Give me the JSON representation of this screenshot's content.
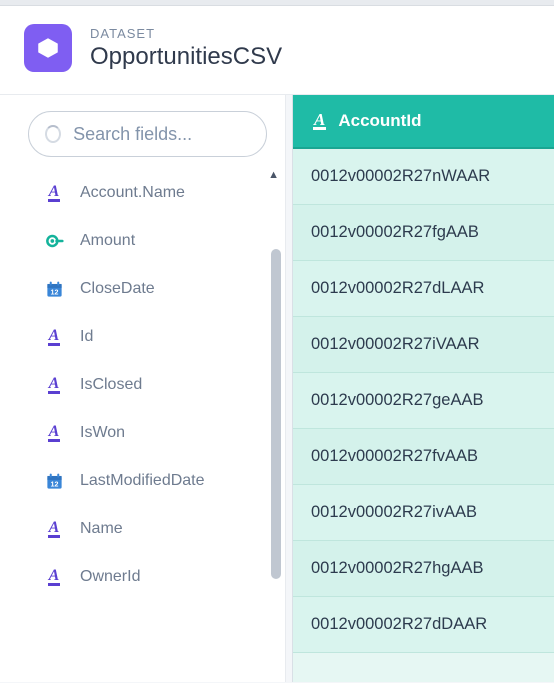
{
  "header": {
    "label": "DATASET",
    "title": "OpportunitiesCSV"
  },
  "search": {
    "placeholder": "Search fields..."
  },
  "fields": [
    {
      "label": "Account.Name",
      "type": "text"
    },
    {
      "label": "Amount",
      "type": "measure"
    },
    {
      "label": "CloseDate",
      "type": "date"
    },
    {
      "label": "Id",
      "type": "text"
    },
    {
      "label": "IsClosed",
      "type": "text"
    },
    {
      "label": "IsWon",
      "type": "text"
    },
    {
      "label": "LastModifiedDate",
      "type": "date"
    },
    {
      "label": "Name",
      "type": "text"
    },
    {
      "label": "OwnerId",
      "type": "text"
    }
  ],
  "column": {
    "name": "AccountId",
    "type": "text"
  },
  "rows": [
    "0012v00002R27nWAAR",
    "0012v00002R27fgAAB",
    "0012v00002R27dLAAR",
    "0012v00002R27iVAAR",
    "0012v00002R27geAAB",
    "0012v00002R27fvAAB",
    "0012v00002R27ivAAB",
    "0012v00002R27hgAAB",
    "0012v00002R27dDAAR"
  ],
  "icons": {
    "text": "A",
    "column_text": "A"
  }
}
